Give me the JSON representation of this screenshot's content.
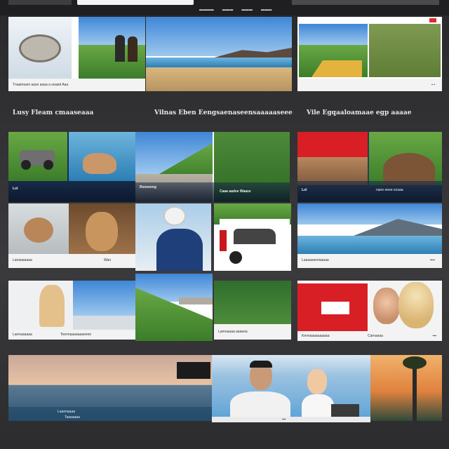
{
  "nav": {
    "items": [
      "▬▬▬▬",
      "▬▬▬",
      "▬▬▬",
      "▬▬▬"
    ]
  },
  "sections": {
    "col1_title": "Lusy Fleam cmaaseaaa",
    "col2_title": "Vilnas Eben Eengsaenaseensaaaaaseee",
    "col3_title": "Vile Egqaaloamaae egp aaaae"
  },
  "row0": {
    "cap1": "Tnaamsam aase aaaa a ueaed Aaa",
    "cap3": "▪ ▪"
  },
  "row1": {
    "cap1": "Lol",
    "cap2a": "Reneeeng",
    "cap2b": "Caaa aadee Waass",
    "cap3a": "Lol",
    "cap3b": "nane eeee ecaaa"
  },
  "row2": {
    "cap1a": "Lanaaaaaaa",
    "cap1b": "Wan",
    "cap3a": "Laaaaaseeaaaaa",
    "cap3b": "▪▪▪▪"
  },
  "row3": {
    "cap1a": "Lannaaaaaa",
    "cap1b": "Teennaaaaaaaeeen",
    "cap2": "Lamnaaaa aaaeea",
    "cap3a": "Kennaaaaaaaaaa",
    "cap3b": "Carnaeaa",
    "cap3c": "▪▪▪"
  },
  "row4": {
    "cap1a": "Laannaaaa",
    "cap1b": "Taaaaaaa",
    "cap2": "▪▪▪"
  }
}
